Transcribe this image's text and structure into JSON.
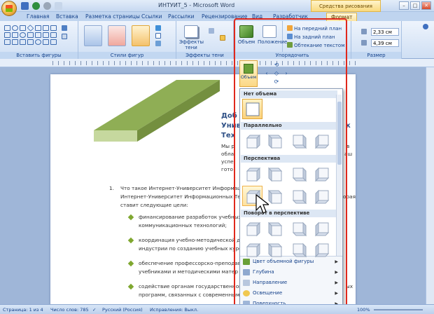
{
  "window": {
    "title": "ИНТУИТ_5 - Microsoft Word",
    "context_tab_title": "Средства рисования"
  },
  "tabs": [
    "Главная",
    "Вставка",
    "Разметка страницы",
    "Ссылки",
    "Рассылки",
    "Рецензирование",
    "Вид",
    "Разработчик",
    "Формат"
  ],
  "active_tab": "Формат",
  "ribbon": {
    "groups": {
      "insert_shapes": "Вставить фигуры",
      "shape_styles": "Стили фигур",
      "shadow_effects": "Эффекты тени",
      "volume_effects": "Объем",
      "arrange": "Упорядочить",
      "size": "Размер"
    },
    "buttons": {
      "shadow_effects": "Эффекты тени",
      "volume": "Объем",
      "position": "Положение",
      "bring_front": "На передний план",
      "send_back": "На задний план",
      "text_wrap": "Обтекание текстом"
    },
    "size": {
      "height": "2,33 см",
      "width": "4,39 см"
    }
  },
  "volume_dropdown_button": "Объем",
  "gallery": {
    "sections": [
      "Нет объема",
      "Параллельно",
      "Перспектива",
      "Поворот в перспективе"
    ],
    "menu": [
      {
        "label": "Цвет объемной фигуры",
        "icon": "color-3d-icon"
      },
      {
        "label": "Глубина",
        "icon": "depth-icon"
      },
      {
        "label": "Направление",
        "icon": "direction-icon"
      },
      {
        "label": "Освещение",
        "icon": "lighting-icon"
      },
      {
        "label": "Поверхность",
        "icon": "surface-icon"
      }
    ]
  },
  "document": {
    "title_lines": [
      "Доб",
      "Унив",
      "Тех"
    ],
    "title_tail": "к",
    "para_lines": [
      "Мы р",
      "обла",
      "успе",
      "гото"
    ],
    "para_tails": [
      "в",
      "аш",
      "",
      ""
    ],
    "item_number": "1.",
    "item_lines": [
      "Что такое Интернет-Университет Информаци",
      "Интернет-Университет Информационных Тех",
      "ставит следующие цели:"
    ],
    "item_tail": "орая",
    "bullets": [
      [
        "финансирование разработок учебных",
        "коммуникационных технологий;"
      ],
      [
        "координация учебно-методической д",
        "индустрии по созданию учебных курс"
      ],
      [
        "обеспечение профессорско-преподав",
        "учебниками и методическими матер"
      ],
      [
        "содействие органам государственной",
        "программ, связанных с современным"
      ]
    ],
    "bullet_tail": "ых"
  },
  "status": {
    "page": "Страница: 1 из 4",
    "words": "Число слов: 785",
    "language": "Русский (Россия)",
    "track": "Исправления: Выкл.",
    "zoom": "100%"
  },
  "colors": {
    "highlight": "#e0281c",
    "accent": "#15428b",
    "shape_top": "#8fae55",
    "shape_front": "#c6d89e"
  }
}
